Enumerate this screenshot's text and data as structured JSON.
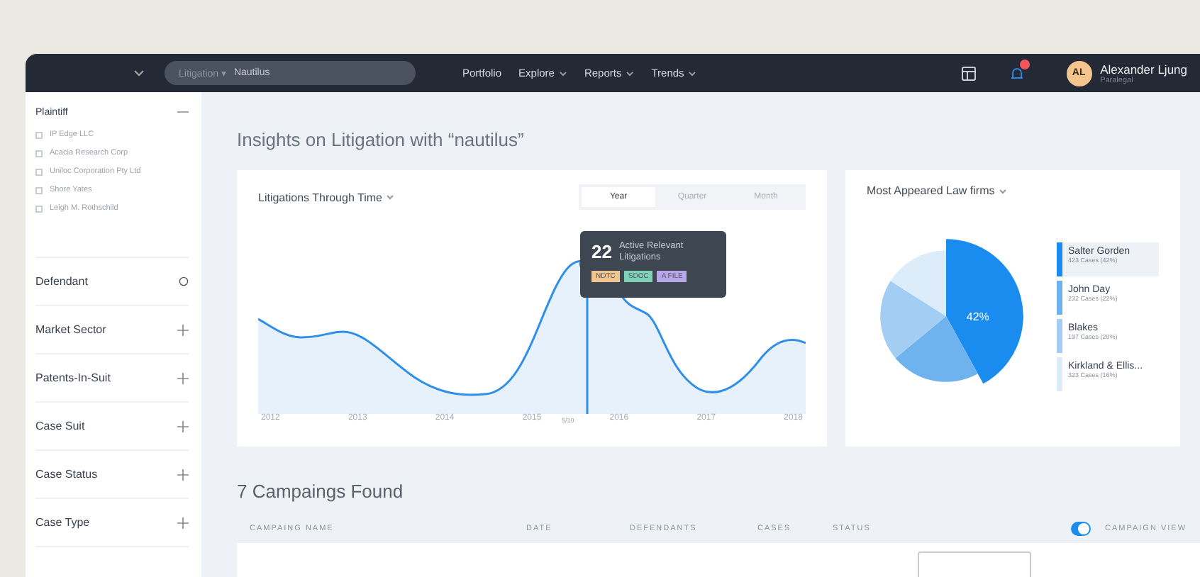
{
  "topbar": {
    "search": {
      "scope": "Litigation ▾",
      "value": "Nautilus"
    },
    "nav": [
      {
        "label": "Portfolio",
        "dropdown": false
      },
      {
        "label": "Explore",
        "dropdown": true
      },
      {
        "label": "Reports",
        "dropdown": true
      },
      {
        "label": "Trends",
        "dropdown": true
      }
    ],
    "notifications": true,
    "user": {
      "initials": "AL",
      "name": "Alexander Ljung",
      "role": "Paralegal"
    }
  },
  "sidebar": {
    "sections": [
      {
        "label": "Plaintiff",
        "kind": "toggle",
        "expanded": true,
        "items": [
          {
            "label": "IP Edge LLC",
            "checked": false
          },
          {
            "label": "Acacia Research Corp",
            "checked": false
          },
          {
            "label": "Uniloc Corporation Pty Ltd",
            "checked": false
          },
          {
            "label": "Shore Yates",
            "checked": false
          },
          {
            "label": "Leigh M. Rothschild",
            "checked": false
          }
        ]
      },
      {
        "label": "Defendant",
        "kind": "info"
      },
      {
        "label": "Market Sector",
        "kind": "toggle",
        "expanded": false
      },
      {
        "label": "Patents-In-Suit",
        "kind": "toggle",
        "expanded": false
      },
      {
        "label": "Case Suit",
        "kind": "toggle",
        "expanded": false
      },
      {
        "label": "Case Status",
        "kind": "toggle",
        "expanded": false
      },
      {
        "label": "Case Type",
        "kind": "toggle",
        "expanded": false
      }
    ]
  },
  "page_title": "Insights on Litigation with “nautilus”",
  "timeline_card": {
    "title": "Litigations Through Time",
    "periods": [
      {
        "label": "Year",
        "selected": true
      },
      {
        "label": "Quarter",
        "selected": false
      },
      {
        "label": "Month",
        "selected": false
      }
    ],
    "x_labels": [
      "2012",
      "2013",
      "2014",
      "2015",
      "2016",
      "2017",
      "2018"
    ],
    "marker_label": "5/10",
    "tooltip": {
      "count": "22",
      "text": "Active Relevant Litigations",
      "tags": [
        {
          "label": "NDTC",
          "color": "#f0c58f"
        },
        {
          "label": "SDOC",
          "color": "#7fd3b8"
        },
        {
          "label": "A FILE",
          "color": "#b9a6e8"
        }
      ]
    }
  },
  "firms_card": {
    "title": "Most Appeared Law firms",
    "center_label": "42%",
    "legend": [
      {
        "name": "Salter Gorden",
        "detail": "423 Cases (42%)",
        "color": "#1a8cf0",
        "selected": true
      },
      {
        "name": "John Day",
        "detail": "232 Cases (22%)",
        "color": "#6fb3ee",
        "selected": false
      },
      {
        "name": "Blakes",
        "detail": "197 Cases (20%)",
        "color": "#a3cdf2",
        "selected": false
      },
      {
        "name": "Kirkland & Ellis...",
        "detail": "323 Cases (16%)",
        "color": "#dcecf9",
        "selected": false
      }
    ]
  },
  "campaigns": {
    "title": "7 Campaings Found",
    "columns": [
      "CAMPAING NAME",
      "DATE",
      "DEFENDANTS",
      "CASES",
      "STATUS"
    ],
    "view_toggle": {
      "label": "CAMPAIGN VIEW",
      "on": true
    }
  }
}
